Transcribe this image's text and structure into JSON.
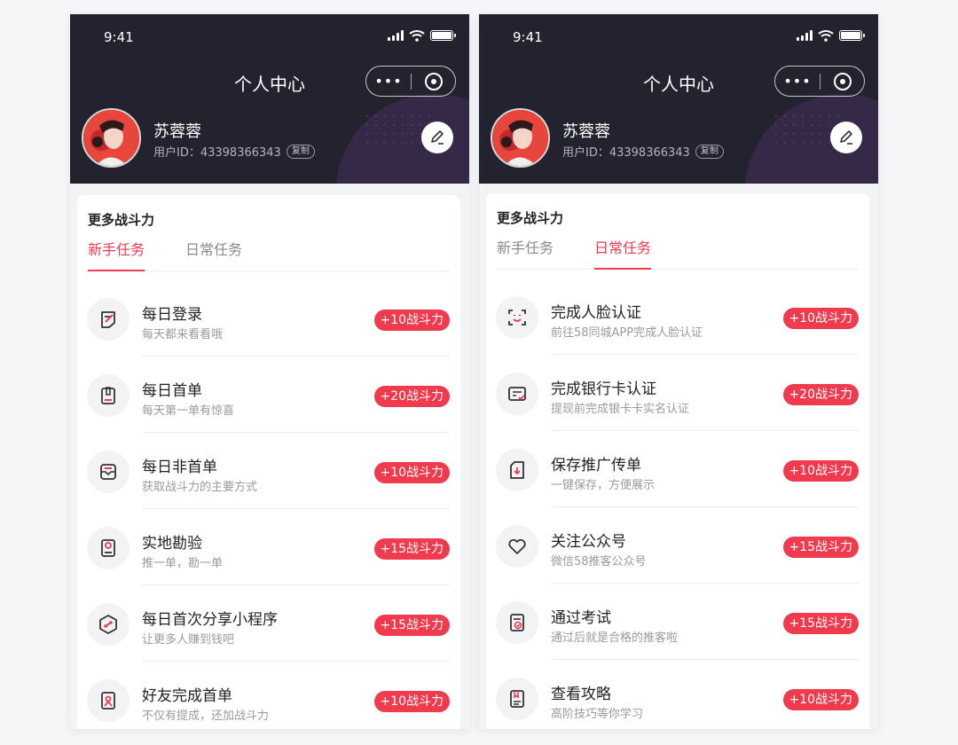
{
  "status": {
    "time": "9:41"
  },
  "page_title": "个人中心",
  "capsule": {
    "more": "•••"
  },
  "user": {
    "name": "苏蓉蓉",
    "id_text": "用户ID：43398366343",
    "copy": "复制"
  },
  "card_title": "更多战斗力",
  "tabs": {
    "newbie": "新手任务",
    "daily": "日常任务"
  },
  "newbie_tasks": [
    {
      "icon": "checkin-icon",
      "title": "每日登录",
      "sub": "每天都来看看哦",
      "reward": "+10战斗力"
    },
    {
      "icon": "clipboard-icon",
      "title": "每日首单",
      "sub": "每天第一单有惊喜",
      "reward": "+20战斗力"
    },
    {
      "icon": "inbox-icon",
      "title": "每日非首单",
      "sub": "获取战斗力的主要方式",
      "reward": "+10战斗力"
    },
    {
      "icon": "location-icon",
      "title": "实地勘验",
      "sub": "推一单，勘一单",
      "reward": "+15战斗力"
    },
    {
      "icon": "share-icon",
      "title": "每日首次分享小程序",
      "sub": "让更多人赚到钱吧",
      "reward": "+15战斗力"
    },
    {
      "icon": "friend-icon",
      "title": "好友完成首单",
      "sub": "不仅有提成，还加战斗力",
      "reward": "+10战斗力"
    }
  ],
  "daily_tasks": [
    {
      "icon": "face-scan-icon",
      "title": "完成人脸认证",
      "sub": "前往58同城APP完成人脸认证",
      "reward": "+10战斗力"
    },
    {
      "icon": "bank-card-icon",
      "title": "完成银行卡认证",
      "sub": "提现前完成银卡卡实名认证",
      "reward": "+20战斗力"
    },
    {
      "icon": "download-flyer-icon",
      "title": "保存推广传单",
      "sub": "一键保存，方便展示",
      "reward": "+10战斗力"
    },
    {
      "icon": "heart-icon",
      "title": "关注公众号",
      "sub": "微信58推客公众号",
      "reward": "+15战斗力"
    },
    {
      "icon": "exam-icon",
      "title": "通过考试",
      "sub": "通过后就是合格的推客啦",
      "reward": "+15战斗力"
    },
    {
      "icon": "guide-icon",
      "title": "查看攻略",
      "sub": "高阶技巧等你学习",
      "reward": "+10战斗力"
    }
  ],
  "colors": {
    "header_bg": "#23232f",
    "accent": "#f03a4e"
  }
}
